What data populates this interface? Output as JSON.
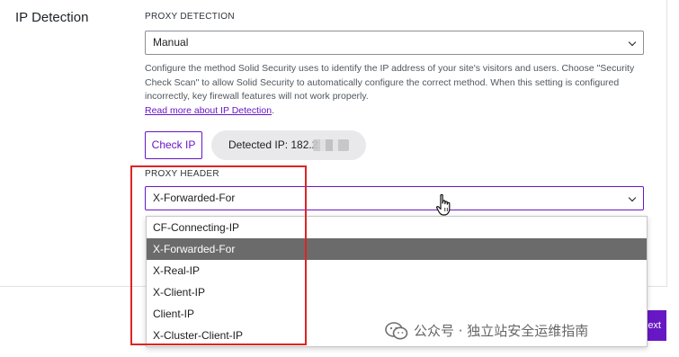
{
  "section": {
    "title": "IP Detection"
  },
  "proxy_detection": {
    "label": "PROXY DETECTION",
    "selected": "Manual",
    "help_text": "Configure the method Solid Security uses to identify the IP address of your site's visitors and users. Choose \"Security Check Scan\" to allow Solid Security to automatically configure the correct method. When this setting is configured incorrectly, key firewall features will not work properly.",
    "help_link": "Read more about IP Detection",
    "help_link_suffix": "."
  },
  "check_ip": {
    "button_label": "Check IP",
    "detected_text": "Detected IP: 182.2"
  },
  "proxy_header": {
    "label": "PROXY HEADER",
    "selected": "X-Forwarded-For",
    "options": [
      "CF-Connecting-IP",
      "X-Forwarded-For",
      "X-Real-IP",
      "X-Client-IP",
      "Client-IP",
      "X-Cluster-Client-IP"
    ],
    "selected_index": 1
  },
  "footer": {
    "next_label": "ext"
  },
  "watermark": {
    "text": "公众号 · 独立站安全运维指南"
  },
  "colors": {
    "accent": "#6817c5",
    "highlight_box": "#e02424",
    "selected_option_bg": "#6b6b6b",
    "pill_bg": "#e9e9ec"
  }
}
